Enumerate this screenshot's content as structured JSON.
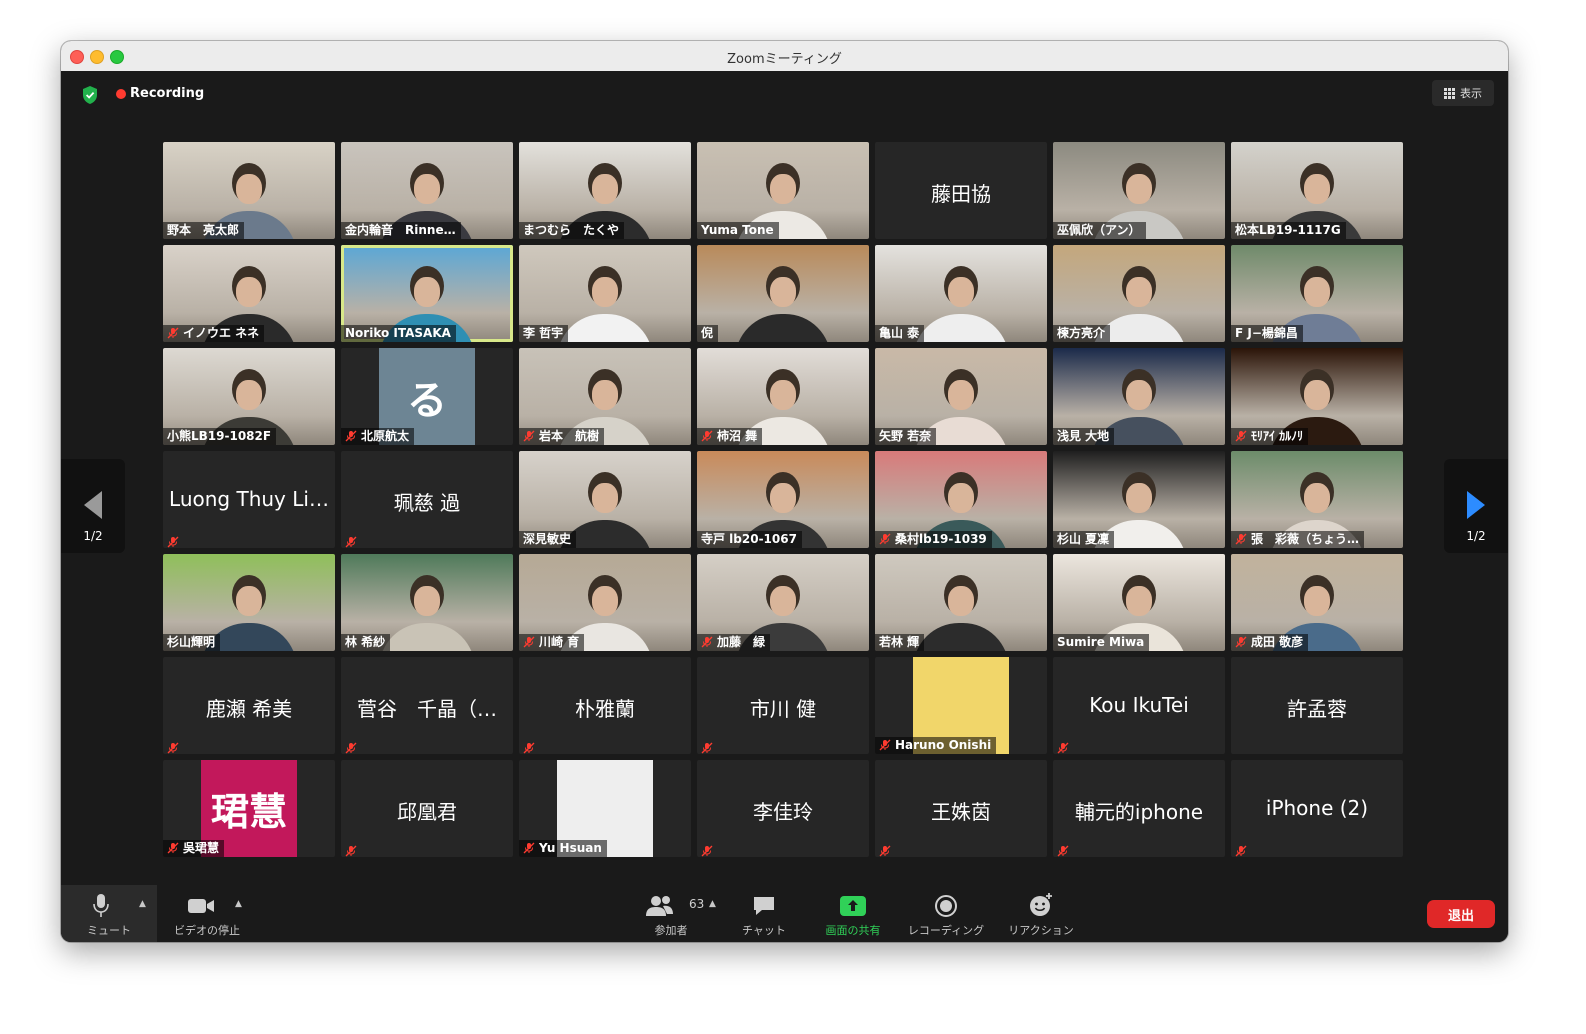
{
  "window": {
    "title": "Zoomミーティング"
  },
  "topbar": {
    "recording_label": "Recording",
    "view_label": "表示"
  },
  "nav": {
    "page_left": "1/2",
    "page_right": "1/2"
  },
  "tiles": [
    {
      "name": "野本　亮太郎",
      "type": "video",
      "muted": false,
      "shirt": "#6b7a8c",
      "bg": "#d8d2c6"
    },
    {
      "name": "金内輪音　Rinne…",
      "type": "video",
      "muted": false,
      "shirt": "#3a3a40",
      "bg": "#c9c4bd"
    },
    {
      "name": "まつむら　たくや",
      "type": "video",
      "muted": false,
      "shirt": "#2c2c2c",
      "bg": "#e3e1dc"
    },
    {
      "name": "Yuma Tone",
      "type": "video",
      "muted": false,
      "shirt": "#ece9e4",
      "bg": "#c9c0b3"
    },
    {
      "name": "藤田協",
      "type": "name",
      "muted": false
    },
    {
      "name": "巫佩欣（アン）",
      "type": "video",
      "muted": false,
      "shirt": "#c9c8c4",
      "bg": "#8c8a80"
    },
    {
      "name": "松本LB19-1117G",
      "type": "video",
      "muted": false,
      "shirt": "#3a3a3a",
      "bg": "#d4d2cc"
    },
    {
      "name": "イノウエ ネネ",
      "type": "video",
      "muted": true,
      "shirt": "#2a2a2a",
      "bg": "#d9d2c9"
    },
    {
      "name": "Noriko ITASAKA",
      "type": "video",
      "muted": false,
      "speaking": true,
      "shirt": "#2f8fb3",
      "bg": "#5aa7d6"
    },
    {
      "name": "李 哲宇",
      "type": "video",
      "muted": false,
      "shirt": "#f2f2f2",
      "bg": "#cfc8bd"
    },
    {
      "name": "倪",
      "type": "video",
      "muted": false,
      "shirt": "#2a2a2a",
      "bg": "#b98a5a"
    },
    {
      "name": "亀山 泰",
      "type": "video",
      "muted": false,
      "shirt": "#eeeeee",
      "bg": "#e4e2de"
    },
    {
      "name": "楝方亮介",
      "type": "video",
      "muted": false,
      "shirt": "#ececec",
      "bg": "#c4a77c"
    },
    {
      "name": "F J−楊錦昌",
      "type": "video",
      "muted": false,
      "shirt": "#6f7d96",
      "bg": "#6f8a6a"
    },
    {
      "name": "小熊LB19-1082F",
      "type": "video",
      "muted": false,
      "shirt": "#3c3b36",
      "bg": "#ddd9d2"
    },
    {
      "name": "北原航太",
      "type": "avatar",
      "muted": true,
      "avatar_text": "る",
      "avatar_bg": "#6d8594"
    },
    {
      "name": "岩本　航樹",
      "type": "video",
      "muted": true,
      "shirt": "#d6d2c9",
      "bg": "#c8c2b8"
    },
    {
      "name": "柿沼 舞",
      "type": "video",
      "muted": true,
      "shirt": "#ece8e2",
      "bg": "#e2ddd8"
    },
    {
      "name": "矢野 若奈",
      "type": "video",
      "muted": false,
      "shirt": "#e8dcd4",
      "bg": "#c9b9a7"
    },
    {
      "name": "浅見 大地",
      "type": "video",
      "muted": false,
      "shirt": "#46505e",
      "bg": "#1b2a4a"
    },
    {
      "name": "ﾓﾘｱｲ ｶﾙﾉﾘ",
      "type": "video",
      "muted": true,
      "shirt": "#2b1a10",
      "bg": "#2b1408"
    },
    {
      "name": "Luong Thuy Li…",
      "type": "name",
      "muted": true
    },
    {
      "name": "珮慈 過",
      "type": "name",
      "muted": true
    },
    {
      "name": "深見敏史",
      "type": "video",
      "muted": false,
      "shirt": "#2c2c2c",
      "bg": "#d7d2cb"
    },
    {
      "name": "寺戸 lb20-1067",
      "type": "video",
      "muted": false,
      "shirt": "#333",
      "bg": "#c98a5a"
    },
    {
      "name": "桑村lb19-1039",
      "type": "video",
      "muted": true,
      "shirt": "#3a5a5a",
      "bg": "#d87a7a"
    },
    {
      "name": "杉山 夏凜",
      "type": "video",
      "muted": false,
      "shirt": "#f1efec",
      "bg": "#1f1f1f"
    },
    {
      "name": "張　彩薇（ちょう…",
      "type": "video",
      "muted": true,
      "shirt": "#ddd5cc",
      "bg": "#6c8c6a"
    },
    {
      "name": "杉山輝明",
      "type": "video",
      "muted": false,
      "shirt": "#33475a",
      "bg": "#8fbf5a"
    },
    {
      "name": "林 希紗",
      "type": "video",
      "muted": false,
      "shirt": "#c9c3b6",
      "bg": "#4f7a5a"
    },
    {
      "name": "川崎 育",
      "type": "video",
      "muted": true,
      "shirt": "#e9e6e1",
      "bg": "#b6a995"
    },
    {
      "name": "加藤　緑",
      "type": "video",
      "muted": true,
      "shirt": "#3b3b3b",
      "bg": "#d5cfc6"
    },
    {
      "name": "若林 輝",
      "type": "video",
      "muted": false,
      "shirt": "#2c2c2c",
      "bg": "#cfc9bf"
    },
    {
      "name": "Sumire Miwa",
      "type": "video",
      "muted": false,
      "shirt": "#eae4da",
      "bg": "#ece6de"
    },
    {
      "name": "成田 敬彦",
      "type": "video",
      "muted": true,
      "shirt": "#4a6b8a",
      "bg": "#c1b29c"
    },
    {
      "name": "鹿瀬 希美",
      "type": "name",
      "muted": true
    },
    {
      "name": "菅谷　千晶（…",
      "type": "name",
      "muted": true
    },
    {
      "name": "朴雅蘭",
      "type": "name",
      "muted": true
    },
    {
      "name": "市川 健",
      "type": "name",
      "muted": true
    },
    {
      "name": "Haruno Onishi",
      "type": "avatar",
      "muted": true,
      "avatar_text": "",
      "avatar_bg": "#f1d66a"
    },
    {
      "name": "Kou IkuTei",
      "type": "name",
      "muted": true
    },
    {
      "name": "許孟蓉",
      "type": "name",
      "muted": false
    },
    {
      "name": "吳珺慧",
      "type": "avatar",
      "muted": true,
      "avatar_text": "珺慧",
      "avatar_bg": "#c2185b"
    },
    {
      "name": "邱凰君",
      "type": "name",
      "muted": true
    },
    {
      "name": "Yu Hsuan",
      "type": "avatar",
      "muted": true,
      "avatar_text": "",
      "avatar_bg": "#eeeeee"
    },
    {
      "name": "李佳玲",
      "type": "name",
      "muted": true
    },
    {
      "name": "王姝茵",
      "type": "name",
      "muted": true
    },
    {
      "name": "輔元的iphone",
      "type": "name",
      "muted": true
    },
    {
      "name": "iPhone (2)",
      "type": "name",
      "muted": true
    }
  ],
  "toolbar": {
    "mute_label": "ミュート",
    "video_label": "ビデオの停止",
    "participants_label": "参加者",
    "participants_count": "63",
    "chat_label": "チャット",
    "share_label": "画面の共有",
    "record_label": "レコーディング",
    "reaction_label": "リアクション",
    "leave_label": "退出"
  },
  "colors": {
    "share_green": "#30d158",
    "leave_red": "#e02828",
    "mute_red": "#ff3b30",
    "speaker_outline": "#d8e88a"
  }
}
